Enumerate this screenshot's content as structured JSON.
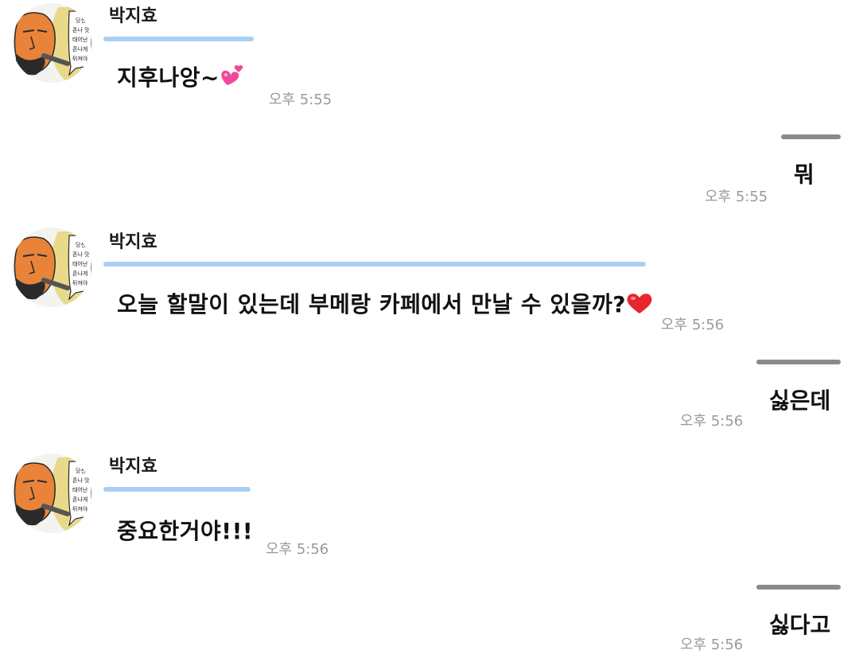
{
  "conversation": {
    "messages": [
      {
        "from": "friend",
        "sender": "박지효",
        "text": "지후나앙~",
        "emoji": "heart-sparkle-icon",
        "time": "오후 5:55"
      },
      {
        "from": "me",
        "text": "뭐",
        "time": "오후 5:55"
      },
      {
        "from": "friend",
        "sender": "박지효",
        "text": "오늘 할말이 있는데 부메랑 카페에서 만날 수 있을까?",
        "emoji": "red-heart-icon",
        "time": "오후 5:56"
      },
      {
        "from": "me",
        "text": "싫은데",
        "time": "오후 5:56"
      },
      {
        "from": "friend",
        "sender": "박지효",
        "text": "중요한거야!!!",
        "time": "오후 5:56"
      },
      {
        "from": "me",
        "text": "싫다고",
        "time": "오후 5:56"
      }
    ]
  },
  "avatar": {
    "caption_lines": [
      "당신",
      "존나 맛",
      "태어난",
      "존나게",
      "뒤져야"
    ],
    "colors": {
      "skin": "#e9833a",
      "hair": "#e9d98a",
      "bubble": "#ffffff",
      "outline": "#2a2a2a"
    }
  },
  "colors": {
    "incoming_bar": "#a9d0f3",
    "outgoing_bar": "#8a8a8a",
    "time_text": "#9a9a9a"
  }
}
